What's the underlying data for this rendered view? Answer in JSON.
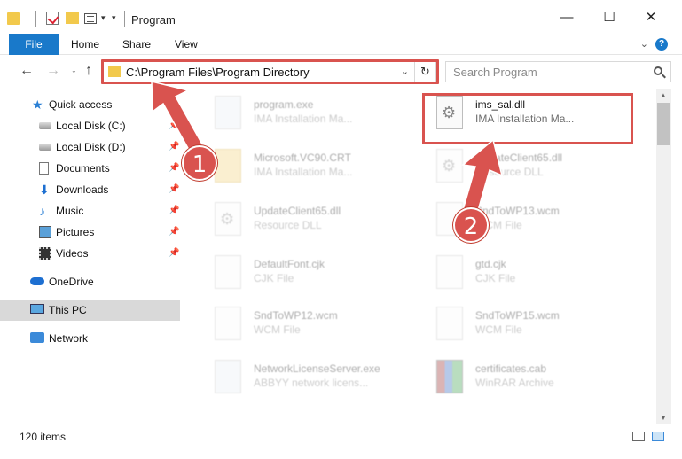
{
  "window": {
    "title": "Program",
    "minimize": "—",
    "maximize": "☐",
    "close": "✕"
  },
  "ribbon": {
    "tabs": [
      "File",
      "Home",
      "Share",
      "View"
    ],
    "expand": "⌄",
    "help": "?"
  },
  "nav": {
    "back": "←",
    "forward": "→",
    "recent": "⌄",
    "up": "↑",
    "address": "C:\\Program Files\\Program Directory",
    "address_dropdown": "⌄",
    "refresh": "↻",
    "search_placeholder": "Search Program"
  },
  "sidebar": {
    "items": [
      {
        "label": "Quick access",
        "icon": "star-icon"
      },
      {
        "label": "Local Disk (C:)",
        "icon": "disk-icon"
      },
      {
        "label": "Local Disk (D:)",
        "icon": "disk-icon"
      },
      {
        "label": "Documents",
        "icon": "document-icon"
      },
      {
        "label": "Downloads",
        "icon": "download-icon"
      },
      {
        "label": "Music",
        "icon": "music-icon"
      },
      {
        "label": "Pictures",
        "icon": "pictures-icon"
      },
      {
        "label": "Videos",
        "icon": "videos-icon"
      },
      {
        "label": "OneDrive",
        "icon": "cloud-icon"
      },
      {
        "label": "This PC",
        "icon": "computer-icon"
      },
      {
        "label": "Network",
        "icon": "network-icon"
      }
    ],
    "pin": "📌"
  },
  "files": [
    {
      "name": "program.exe",
      "type": "IMA Installation Ma..."
    },
    {
      "name": "ims_sal.dll",
      "type": "IMA Installation Ma..."
    },
    {
      "name": "Microsoft.VC90.CRT",
      "type": "IMA Installation Ma..."
    },
    {
      "name": "UpdateClient65.dll",
      "type": "Resource DLL"
    },
    {
      "name": "UpdateClient65.dll",
      "type": "Resource DLL"
    },
    {
      "name": "SndToWP13.wcm",
      "type": "WCM File"
    },
    {
      "name": "DefaultFont.cjk",
      "type": "CJK File"
    },
    {
      "name": "gtd.cjk",
      "type": "CJK File"
    },
    {
      "name": "SndToWP12.wcm",
      "type": "WCM File"
    },
    {
      "name": "SndToWP15.wcm",
      "type": "WCM File"
    },
    {
      "name": "NetworkLicenseServer.exe",
      "type": "ABBYY network licens..."
    },
    {
      "name": "certificates.cab",
      "type": "WinRAR Archive"
    }
  ],
  "status": {
    "count": "120 items"
  },
  "annotations": {
    "step1": "1",
    "step2": "2",
    "color": "#d9534f"
  },
  "scroll": {
    "up": "▲",
    "down": "▼"
  }
}
